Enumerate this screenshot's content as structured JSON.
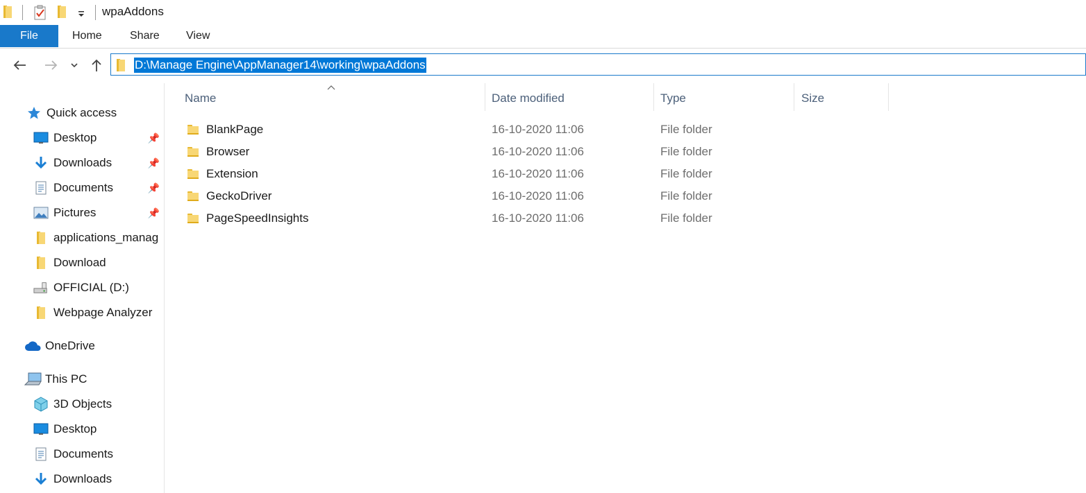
{
  "window": {
    "title": "wpaAddons"
  },
  "qat": {
    "icons": [
      "folder-icon",
      "properties-icon",
      "new-folder-icon",
      "customize-qat-chevron-icon"
    ]
  },
  "ribbon": {
    "tabs": [
      "File",
      "Home",
      "Share",
      "View"
    ],
    "accent": "#1979ca"
  },
  "address_bar": {
    "path": "D:\\Manage Engine\\AppManager14\\working\\wpaAddons",
    "selection_color": "#0078d7"
  },
  "nav_pane": {
    "quick_access": {
      "label": "Quick access",
      "items": [
        {
          "label": "Desktop",
          "icon": "desktop-icon",
          "pinned": true
        },
        {
          "label": "Downloads",
          "icon": "download-arrow-icon",
          "pinned": true
        },
        {
          "label": "Documents",
          "icon": "documents-icon",
          "pinned": true
        },
        {
          "label": "Pictures",
          "icon": "pictures-icon",
          "pinned": true
        },
        {
          "label": "applications_manag",
          "icon": "folder-icon",
          "pinned": false
        },
        {
          "label": "Download",
          "icon": "folder-icon",
          "pinned": false
        },
        {
          "label": "OFFICIAL (D:)",
          "icon": "drive-icon",
          "pinned": false
        },
        {
          "label": "Webpage Analyzer",
          "icon": "folder-icon",
          "pinned": false
        }
      ]
    },
    "onedrive": {
      "label": "OneDrive"
    },
    "this_pc": {
      "label": "This PC",
      "items": [
        {
          "label": "3D Objects",
          "icon": "3d-objects-icon"
        },
        {
          "label": "Desktop",
          "icon": "desktop-icon"
        },
        {
          "label": "Documents",
          "icon": "documents-icon"
        },
        {
          "label": "Downloads",
          "icon": "download-arrow-icon"
        }
      ]
    }
  },
  "file_list": {
    "columns": [
      "Name",
      "Date modified",
      "Type",
      "Size"
    ],
    "rows": [
      {
        "name": "BlankPage",
        "date": "16-10-2020 11:06",
        "type": "File folder",
        "size": ""
      },
      {
        "name": "Browser",
        "date": "16-10-2020 11:06",
        "type": "File folder",
        "size": ""
      },
      {
        "name": "Extension",
        "date": "16-10-2020 11:06",
        "type": "File folder",
        "size": ""
      },
      {
        "name": "GeckoDriver",
        "date": "16-10-2020 11:06",
        "type": "File folder",
        "size": ""
      },
      {
        "name": "PageSpeedInsights",
        "date": "16-10-2020 11:06",
        "type": "File folder",
        "size": ""
      }
    ]
  }
}
